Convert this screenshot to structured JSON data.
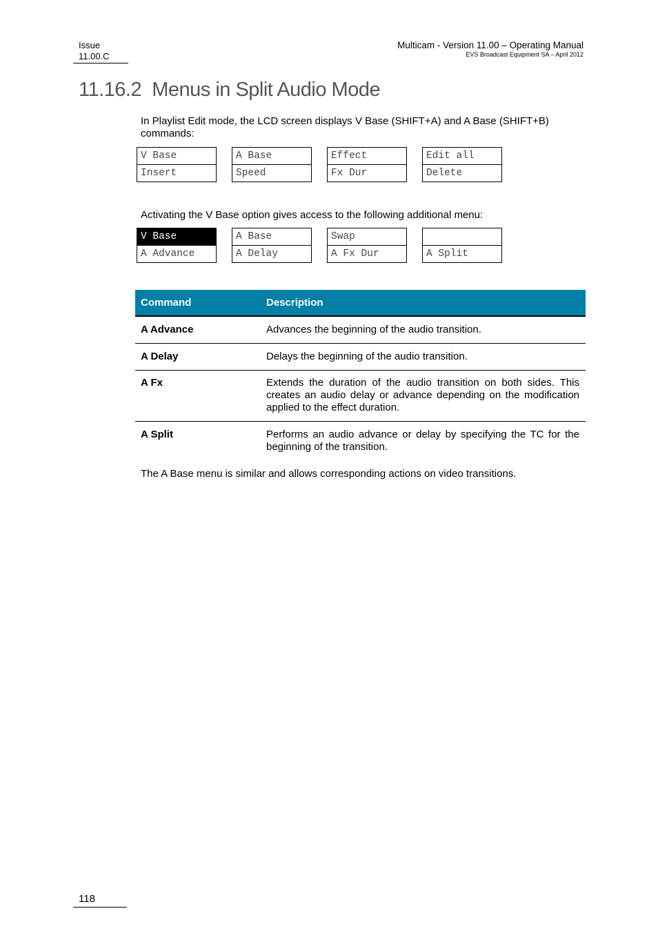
{
  "header": {
    "issue_label": "Issue",
    "issue_value": "11.00.C",
    "manual_title": "Multicam - Version 11.00 – Operating Manual",
    "publisher": "EVS Broadcast Equipment SA – April 2012"
  },
  "section_title": "11.16.2  Menus in Split Audio Mode",
  "intro_text": "In Playlist Edit mode, the LCD screen displays V Base (SHIFT+A) and A Base (SHIFT+B) commands:",
  "lcd_menu_1": [
    {
      "top": "V Base",
      "bottom": "Insert"
    },
    {
      "top": "A Base",
      "bottom": "Speed"
    },
    {
      "top": "Effect",
      "bottom": "Fx Dur"
    },
    {
      "top": "Edit all",
      "bottom": "Delete"
    }
  ],
  "activation_text": "Activating the V Base option gives access to the following additional menu:",
  "lcd_menu_2": [
    {
      "top": "V Base",
      "bottom": "A Advance",
      "top_highlighted": true
    },
    {
      "top": "A Base",
      "bottom": "A Delay"
    },
    {
      "top": "Swap",
      "bottom": "A Fx Dur"
    },
    {
      "top": "",
      "bottom": "A Split"
    }
  ],
  "table": {
    "header_color": "#0080A6",
    "columns": [
      "Command",
      "Description"
    ],
    "rows": [
      {
        "command": "A Advance",
        "description": "Advances the beginning of the audio transition."
      },
      {
        "command": "A Delay",
        "description": "Delays the beginning of the audio transition."
      },
      {
        "command": "A Fx",
        "description": "Extends the duration of the audio transition on both sides. This creates an audio delay or advance depending on the modification applied to the effect duration."
      },
      {
        "command": "A Split",
        "description": "Performs an audio advance or delay by specifying the TC for the beginning of the transition."
      }
    ]
  },
  "closing_text": "The A Base menu is similar and allows corresponding actions on video transitions.",
  "footer": {
    "page_number": "118"
  }
}
